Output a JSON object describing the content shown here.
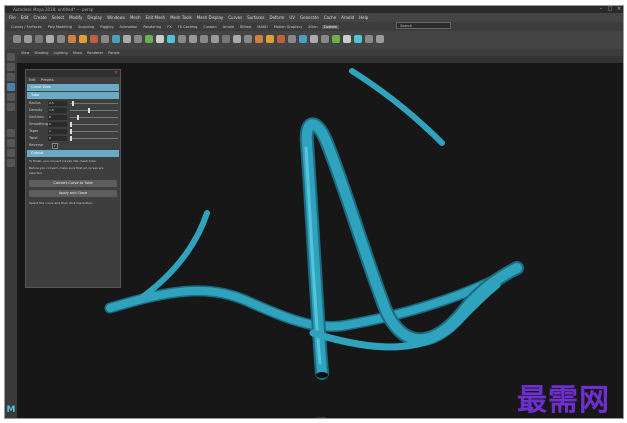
{
  "window": {
    "title": "Autodesk Maya 2018: untitled*  ---  persp"
  },
  "menu_bar": [
    "File",
    "Edit",
    "Create",
    "Select",
    "Modify",
    "Display",
    "Windows",
    "Mesh",
    "Edit Mesh",
    "Mesh Tools",
    "Mesh Display",
    "Curves",
    "Surfaces",
    "Deform",
    "UV",
    "Generate",
    "Cache",
    "Arnold",
    "Help"
  ],
  "shelf_tabs": [
    "Curves / Surfaces",
    "Poly Modeling",
    "Sculpting",
    "Rigging",
    "Animation",
    "Rendering",
    "FX",
    "FX Caching",
    "Custom",
    "Arnold",
    "Bifrost",
    "MASH",
    "Motion Graphics",
    "XGen",
    "Custom"
  ],
  "shelf_active_index": 14,
  "search": {
    "placeholder": "Search"
  },
  "panel_menu": [
    "View",
    "Shading",
    "Lighting",
    "Show",
    "Renderer",
    "Panels"
  ],
  "camera_label": "persp",
  "dialog": {
    "title": "",
    "menu": [
      "Edit",
      "Presets"
    ],
    "section1": "Curve Tube",
    "section2": "Tube",
    "fields": [
      {
        "label": "Radius",
        "value": "0.5",
        "slider": 0.05
      },
      {
        "label": "Density",
        "value": "1.5",
        "slider": 0.4
      },
      {
        "label": "Sections",
        "value": "8",
        "slider": 0.15
      },
      {
        "label": "Smoothing",
        "value": "0",
        "slider": 0.0
      },
      {
        "label": "Taper",
        "value": "1",
        "slider": 0.0
      },
      {
        "label": "Twist",
        "value": "0",
        "slider": 0.0
      }
    ],
    "check_label": "Reverse",
    "check_checked": true,
    "section3": "Output",
    "note1": "To finish, you convert curves into mesh tube.",
    "note2": "Before you convert, make sure that all curves are selected.",
    "button1": "Convert Curve to Tube",
    "button2": "Apply and Close",
    "footer": "Select the curve and then click the button."
  },
  "watermark": "最需网",
  "colors": {
    "tube": "#2fa3bd",
    "tube_highlight": "#56c3da",
    "tube_shadow": "#1b6c80",
    "section": "#6aaac5",
    "watermark": "#6f2fcf"
  }
}
